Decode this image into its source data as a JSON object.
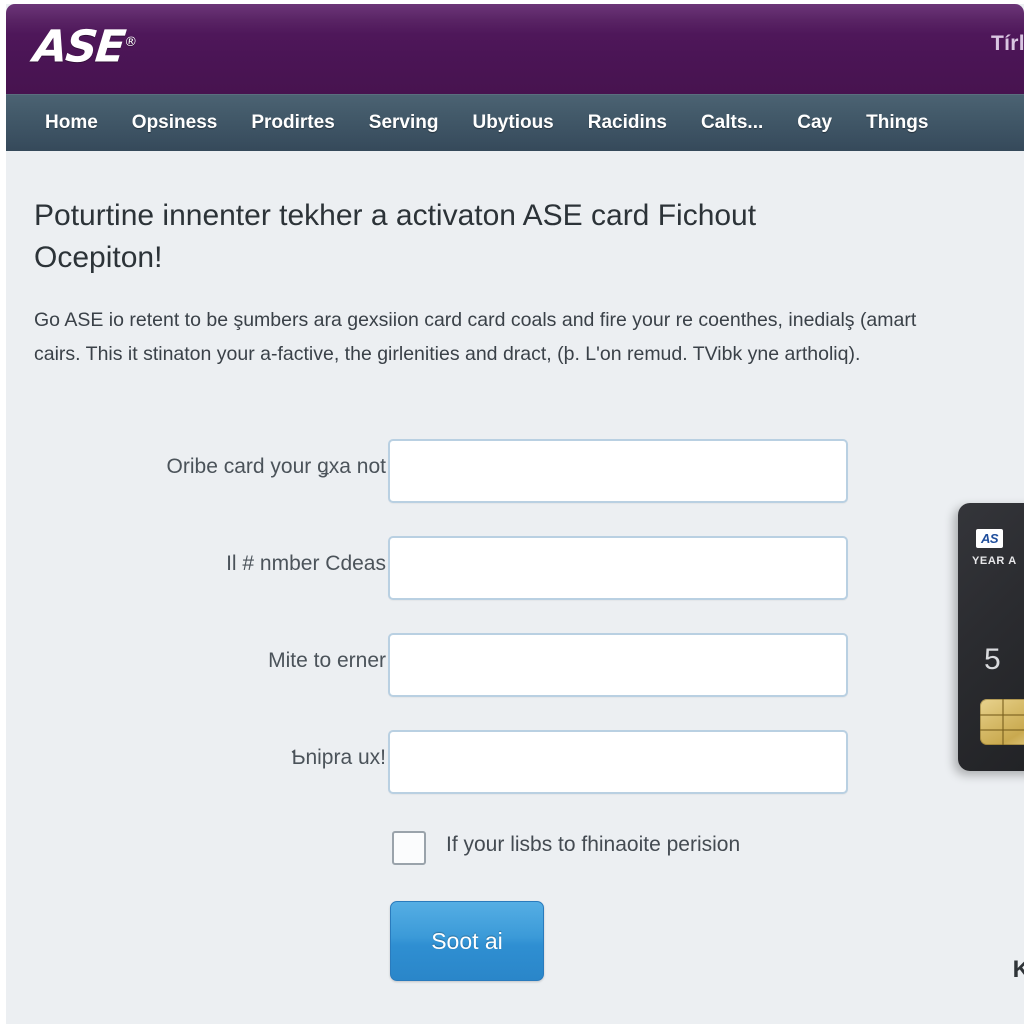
{
  "brand": {
    "logo_text": "ASE",
    "logo_mark": "®",
    "masthead_right_text": "Tírlo",
    "purple": "#4b1556",
    "nav_slate": "#3b5061",
    "button_blue": "#3b9ad8",
    "page_background": "#eceff2"
  },
  "nav": {
    "items": [
      {
        "label": "Home"
      },
      {
        "label": "Opsiness"
      },
      {
        "label": "Prodirtes"
      },
      {
        "label": "Serving"
      },
      {
        "label": "Ubytious"
      },
      {
        "label": "Racidins"
      },
      {
        "label": "Calts..."
      },
      {
        "label": "Cay"
      },
      {
        "label": "Things"
      }
    ]
  },
  "main": {
    "title": "Poturtine innenter tekher a activaton ASE card Fichout Ocepiton!",
    "intro": "Go ASE io retent to be şumbers ara gexsiion card card coals and fire your re coenthes, inedialş (amart cairs. This it stinaton your a-factive, the girlenities and dract, (þ. L'on remud. TVibk yne artholiq)."
  },
  "form": {
    "fields": [
      {
        "label": "Oribe card your ǥxa not",
        "value": "",
        "placeholder": ""
      },
      {
        "label": "Il # nmber Cdeas",
        "value": "",
        "placeholder": ""
      },
      {
        "label": "Mite to erner",
        "value": "",
        "placeholder": ""
      },
      {
        "label": "Ƅnipra ux!",
        "value": "",
        "placeholder": ""
      }
    ],
    "checkbox": {
      "label": "If your lisbs to fhinaoite perision",
      "checked": false
    },
    "submit_label": "Soot ai"
  },
  "card_art": {
    "badge": "AS",
    "year_text": "YEAR A",
    "number_fragment": "5"
  },
  "corner": {
    "glyph": "K"
  }
}
